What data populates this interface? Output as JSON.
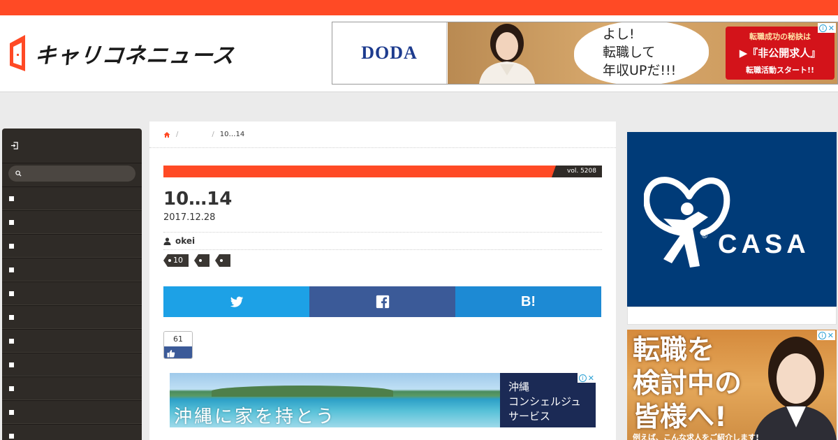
{
  "colors": {
    "brand": "#ff4a25",
    "sidebar": "#2f2b27",
    "twitter": "#1da1e6",
    "facebook": "#3b5a98",
    "hatena": "#1d8ad4"
  },
  "header": {
    "logo_text": "キャリコネニュース",
    "ad": {
      "brand": "DODA",
      "speech_lines": [
        "よし!",
        "転職して",
        "年収UPだ!!!"
      ],
      "cta_line1": "転職成功の秘訣は",
      "cta_line2": "▶『非公開求人』",
      "cta_line3": "転職活動スタート!!"
    }
  },
  "sidebar": {
    "login_icon": "login-icon",
    "search_placeholder": "",
    "item_count_label": "",
    "items": [
      "",
      "",
      "",
      "",
      "",
      "",
      "",
      "",
      "",
      "",
      ""
    ]
  },
  "breadcrumb": {
    "home_icon": "home-icon",
    "category": "",
    "current": "10…14"
  },
  "article": {
    "vol": "vol. 5208",
    "title": "10…14",
    "date": "2017.12.28",
    "author": "okei",
    "tags": [
      "10",
      "",
      ""
    ]
  },
  "share": {
    "twitter_icon": "twitter-icon",
    "facebook_icon": "facebook-icon",
    "hatena_label": "B!"
  },
  "like": {
    "count": "61"
  },
  "inline_ad": {
    "headline": "沖縄に家を持とう",
    "side_lines": [
      "沖縄",
      "コンシェルジュ",
      "サービス"
    ]
  },
  "right_ads": {
    "casa_name": "CASA",
    "recruit_lines": [
      "転職を",
      "検討中の",
      "皆様へ!"
    ],
    "recruit_small": "例えば、こんな求人をご紹介します!"
  }
}
